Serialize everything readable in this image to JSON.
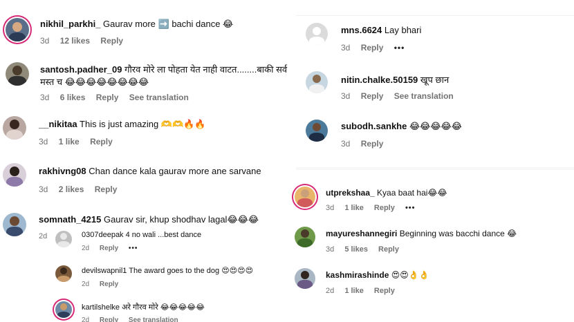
{
  "left": {
    "comments": [
      {
        "user": "nikhil_parkhi_",
        "text": "Gaurav more ➡️ bachi dance 😂",
        "time": "3d",
        "likes": "12 likes",
        "reply": "Reply"
      },
      {
        "user": "santosh.padher_09",
        "text": "गौरव मोरे ला पोहता येत नाही वाटत........बाकी सर्व",
        "text2": "मस्त च 😂😂😂😂😂😂😂😂",
        "time": "3d",
        "likes": "6 likes",
        "reply": "Reply",
        "translate": "See translation"
      },
      {
        "user": "__nikitaa",
        "text": "This is just amazing 🫶🫶🔥🔥",
        "time": "3d",
        "likes": "1 like",
        "reply": "Reply"
      },
      {
        "user": "rakhivng08",
        "text": "Chan dance kala gaurav more ane sarvane",
        "time": "3d",
        "likes": "2 likes",
        "reply": "Reply"
      },
      {
        "user": "somnath_4215",
        "text": "Gaurav sir, khup shodhav lagal😂😂😂",
        "time": "2d",
        "likes": "",
        "reply": ""
      }
    ],
    "replies": [
      {
        "user": "0307deepak",
        "text": "4 no wali ...best dance",
        "time": "2d",
        "reply": "Reply",
        "more": "•••"
      },
      {
        "user": "devilswapnil1",
        "text": "The award goes to the dog 😍😍😍😍",
        "time": "2d",
        "reply": "Reply"
      },
      {
        "user": "kartilshelke",
        "text": "अरे गौरव मोरे 😂😂😂😂😂",
        "time": "2d",
        "reply": "Reply",
        "translate": "See translation"
      }
    ]
  },
  "right_top": {
    "comments": [
      {
        "user": "mns.6624",
        "text": "Lay bhari",
        "time": "3d",
        "reply": "Reply",
        "more": "•••"
      },
      {
        "user": "nitin.chalke.50159",
        "text": "खूप छान",
        "time": "3d",
        "reply": "Reply",
        "translate": "See translation"
      },
      {
        "user": "subodh.sankhe",
        "text": "😂😂😂😂😂",
        "time": "3d",
        "reply": "Reply"
      }
    ]
  },
  "right_bottom": {
    "comments": [
      {
        "user": "utprekshaa_",
        "text": "Kyaa baat hai😂😂",
        "time": "3d",
        "likes": "1 like",
        "reply": "Reply",
        "more": "•••"
      },
      {
        "user": "mayureshannegiri",
        "text": "Beginning was bacchi dance 😂",
        "time": "3d",
        "likes": "5 likes",
        "reply": "Reply"
      },
      {
        "user": "kashmirashinde",
        "text": "😍😍👌👌",
        "time": "2d",
        "likes": "1 like",
        "reply": "Reply"
      }
    ]
  },
  "colors": {
    "meta": "#737373",
    "text": "#111111",
    "story_ring": "#d62976"
  }
}
